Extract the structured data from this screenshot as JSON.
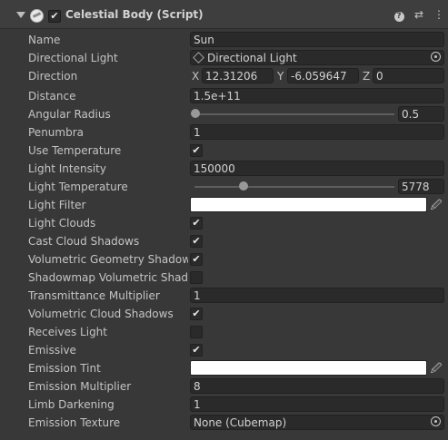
{
  "header": {
    "title": "Celestial Body (Script)",
    "enabled_check": "✔",
    "help": "?",
    "presets": "⇄",
    "menu": "⋮"
  },
  "fields": {
    "name": {
      "label": "Name",
      "value": "Sun"
    },
    "directional_light": {
      "label": "Directional Light",
      "value": "Directional Light"
    },
    "direction": {
      "label": "Direction",
      "x_label": "X",
      "x": "12.31206",
      "y_label": "Y",
      "y": "-6.059647",
      "z_label": "Z",
      "z": "0"
    },
    "distance": {
      "label": "Distance",
      "value": "1.5e+11"
    },
    "angular_radius": {
      "label": "Angular Radius",
      "value": "0.5",
      "slider_fraction": 0.0
    },
    "penumbra": {
      "label": "Penumbra",
      "value": "1"
    },
    "use_temperature": {
      "label": "Use Temperature",
      "checked": true
    },
    "light_intensity": {
      "label": "Light Intensity",
      "value": "150000"
    },
    "light_temperature": {
      "label": "Light Temperature",
      "value": "5778",
      "slider_fraction": 0.28
    },
    "light_filter": {
      "label": "Light Filter",
      "color": "#ffffff"
    },
    "light_clouds": {
      "label": "Light Clouds",
      "checked": true
    },
    "cast_cloud_shadows": {
      "label": "Cast Cloud Shadows",
      "checked": true
    },
    "volumetric_geometry_shadows": {
      "label": "Volumetric Geometry Shadows",
      "checked": true
    },
    "shadowmap_volumetric_shadows": {
      "label": "Shadowmap Volumetric Shadows",
      "checked": false
    },
    "transmittance_multiplier": {
      "label": "Transmittance Multiplier",
      "value": "1"
    },
    "volumetric_cloud_shadows": {
      "label": "Volumetric Cloud Shadows",
      "checked": true
    },
    "receives_light": {
      "label": "Receives Light",
      "checked": false
    },
    "emissive": {
      "label": "Emissive",
      "checked": true
    },
    "emission_tint": {
      "label": "Emission Tint",
      "color": "#ffffff"
    },
    "emission_multiplier": {
      "label": "Emission Multiplier",
      "value": "8"
    },
    "limb_darkening": {
      "label": "Limb Darkening",
      "value": "1"
    },
    "emission_texture": {
      "label": "Emission Texture",
      "value": "None (Cubemap)"
    }
  },
  "icons": {
    "checkmark": "✔",
    "eyedropper": "eyedropper-icon",
    "object_picker": "object-picker-icon"
  }
}
